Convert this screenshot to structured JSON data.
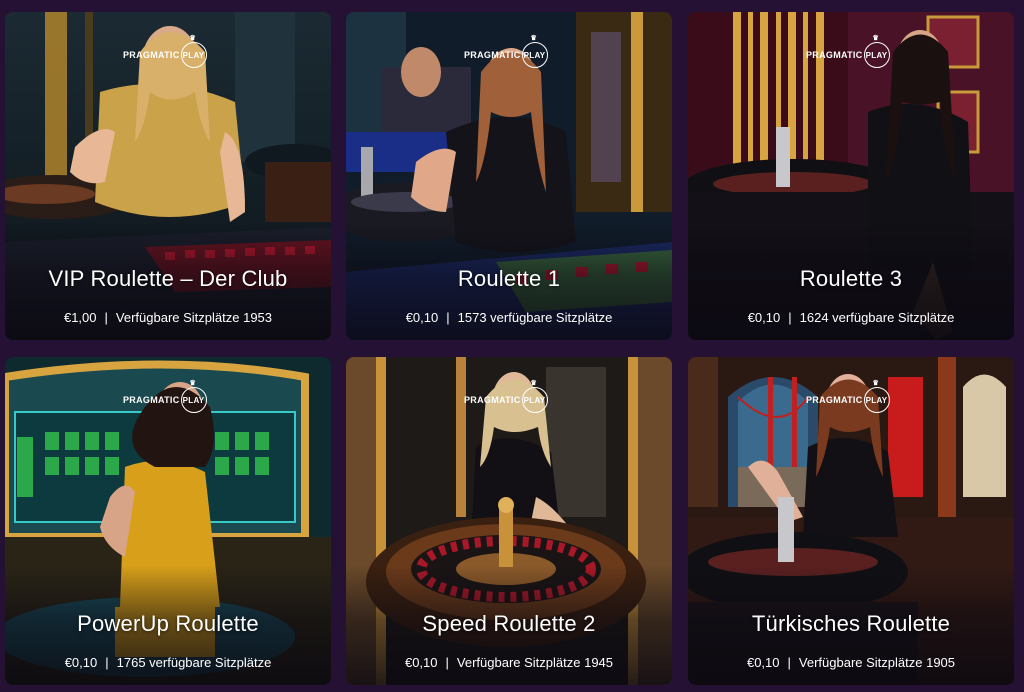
{
  "provider": {
    "name": "PRAGMATIC",
    "badge": "PLAY"
  },
  "colors": {
    "page_bg": "#241133",
    "text": "#ffffff"
  },
  "games": [
    {
      "title": "VIP Roulette – Der Club",
      "bet": "€1,00",
      "seats": "Verfügbare Sitzplätze 1953"
    },
    {
      "title": "Roulette 1",
      "bet": "€0,10",
      "seats": "1573 verfügbare Sitzplätze"
    },
    {
      "title": "Roulette 3",
      "bet": "€0,10",
      "seats": "1624 verfügbare Sitzplätze"
    },
    {
      "title": "PowerUp Roulette",
      "bet": "€0,10",
      "seats": "1765 verfügbare Sitzplätze"
    },
    {
      "title": "Speed Roulette 2",
      "bet": "€0,10",
      "seats": "Verfügbare Sitzplätze 1945"
    },
    {
      "title": "Türkisches Roulette",
      "bet": "€0,10",
      "seats": "Verfügbare Sitzplätze 1905"
    }
  ],
  "separator": "|"
}
